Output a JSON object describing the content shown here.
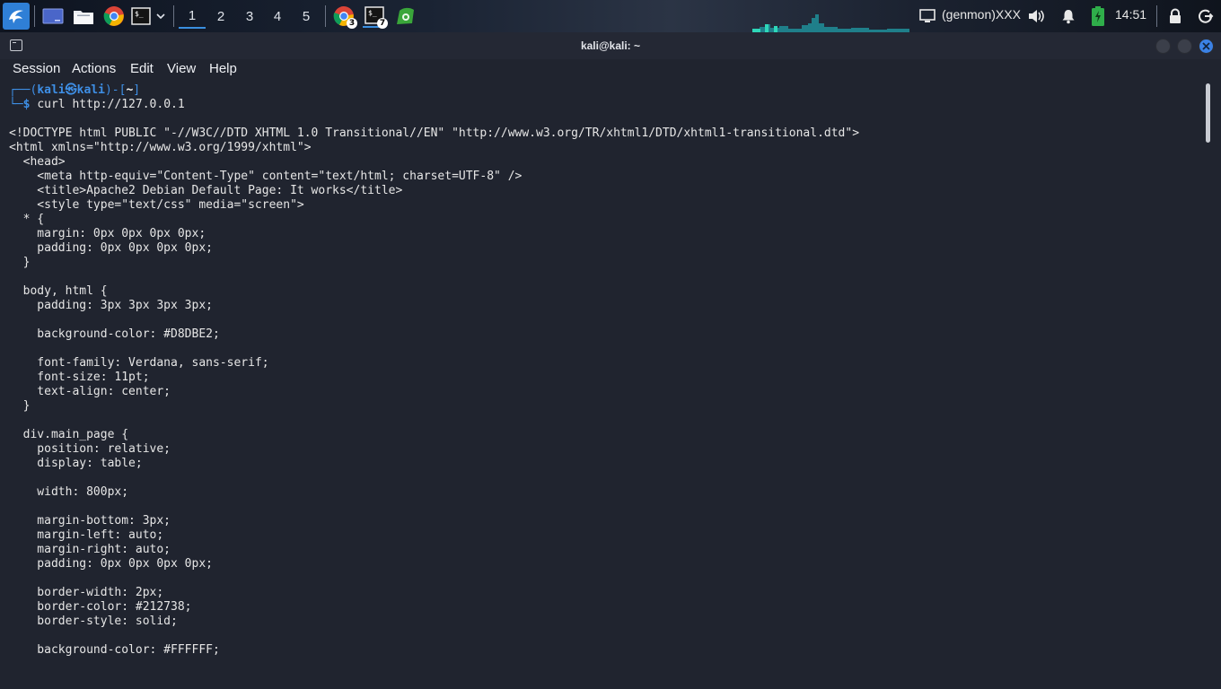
{
  "taskbar": {
    "workspaces": [
      "1",
      "2",
      "3",
      "4",
      "5"
    ],
    "chrome_badge": "3",
    "terminal_badge": "7",
    "genmon": "(genmon)XXX",
    "clock": "14:51"
  },
  "window": {
    "title": "kali@kali: ~"
  },
  "menu": [
    "Session",
    "Actions",
    "Edit",
    "View",
    "Help"
  ],
  "prompt": {
    "corner_top": "┌──(",
    "user": "kali",
    "at": "㉿",
    "host": "kali",
    "mid": ")-[",
    "dir": "~",
    "end": "]",
    "corner_bottom": "└─",
    "dollar": "$",
    "command": "curl http://127.0.0.1"
  },
  "output": [
    "<!DOCTYPE html PUBLIC \"-//W3C//DTD XHTML 1.0 Transitional//EN\" \"http://www.w3.org/TR/xhtml1/DTD/xhtml1-transitional.dtd\">",
    "<html xmlns=\"http://www.w3.org/1999/xhtml\">",
    "  <head>",
    "    <meta http-equiv=\"Content-Type\" content=\"text/html; charset=UTF-8\" />",
    "    <title>Apache2 Debian Default Page: It works</title>",
    "    <style type=\"text/css\" media=\"screen\">",
    "  * {",
    "    margin: 0px 0px 0px 0px;",
    "    padding: 0px 0px 0px 0px;",
    "  }",
    "",
    "  body, html {",
    "    padding: 3px 3px 3px 3px;",
    "",
    "    background-color: #D8DBE2;",
    "",
    "    font-family: Verdana, sans-serif;",
    "    font-size: 11pt;",
    "    text-align: center;",
    "  }",
    "",
    "  div.main_page {",
    "    position: relative;",
    "    display: table;",
    "",
    "    width: 800px;",
    "",
    "    margin-bottom: 3px;",
    "    margin-left: auto;",
    "    margin-right: auto;",
    "    padding: 0px 0px 0px 0px;",
    "",
    "    border-width: 2px;",
    "    border-color: #212738;",
    "    border-style: solid;",
    "",
    "    background-color: #FFFFFF;"
  ]
}
